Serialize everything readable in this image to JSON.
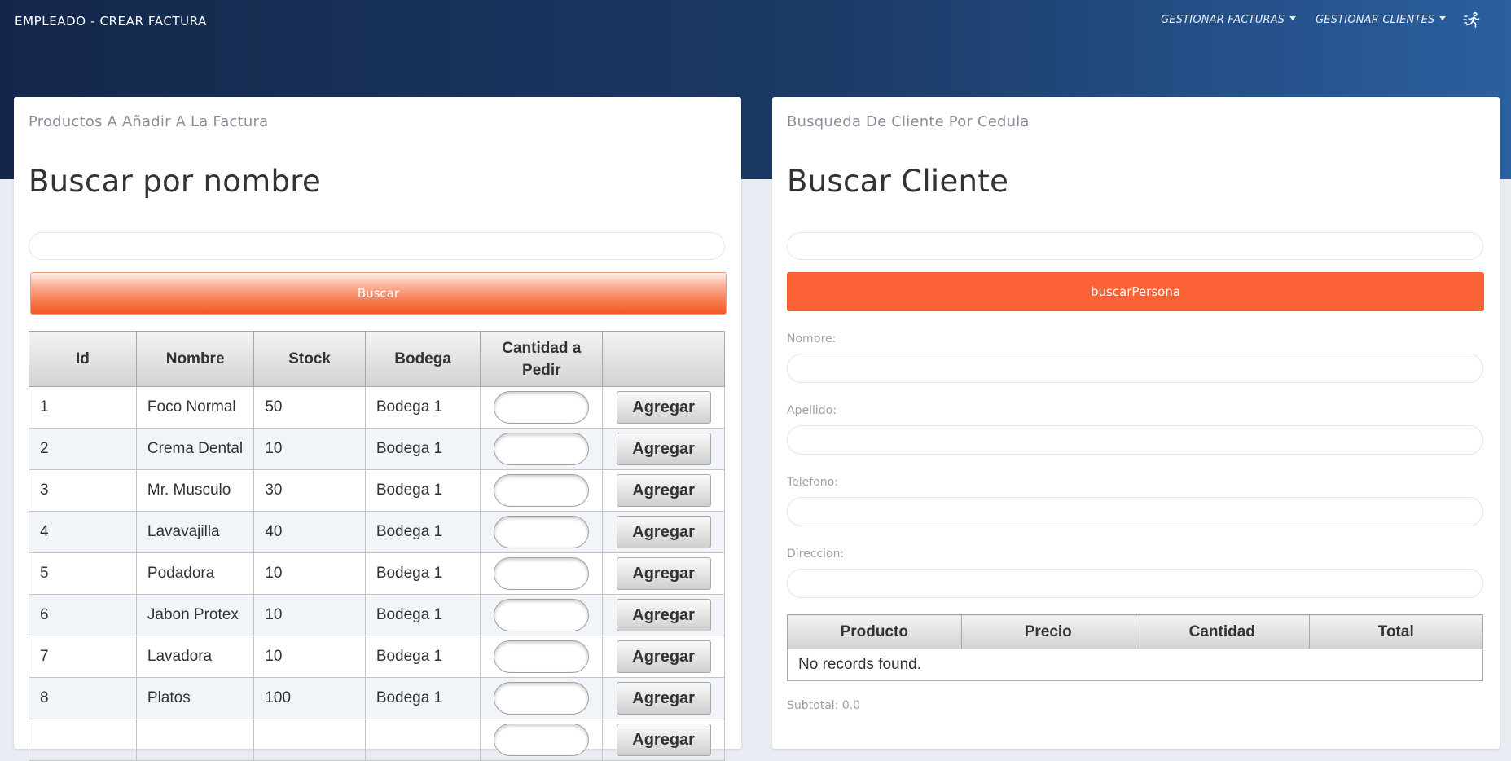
{
  "header": {
    "brand": "EMPLEADO - CREAR FACTURA",
    "menu": [
      {
        "label": "GESTIONAR FACTURAS"
      },
      {
        "label": "GESTIONAR CLIENTES"
      }
    ],
    "logout_icon": "running-person-icon"
  },
  "products_panel": {
    "header": "Productos A Añadir A La Factura",
    "heading": "Buscar por nombre",
    "search_value": "",
    "search_button": "Buscar",
    "columns": [
      "Id",
      "Nombre",
      "Stock",
      "Bodega",
      "Cantidad a Pedir",
      ""
    ],
    "add_label": "Agregar",
    "rows": [
      {
        "id": "1",
        "nombre": "Foco Normal",
        "stock": "50",
        "bodega": "Bodega 1"
      },
      {
        "id": "2",
        "nombre": "Crema Dental",
        "stock": "10",
        "bodega": "Bodega 1"
      },
      {
        "id": "3",
        "nombre": "Mr. Musculo",
        "stock": "30",
        "bodega": "Bodega 1"
      },
      {
        "id": "4",
        "nombre": "Lavavajilla",
        "stock": "40",
        "bodega": "Bodega 1"
      },
      {
        "id": "5",
        "nombre": "Podadora",
        "stock": "10",
        "bodega": "Bodega 1"
      },
      {
        "id": "6",
        "nombre": "Jabon Protex",
        "stock": "10",
        "bodega": "Bodega 1"
      },
      {
        "id": "7",
        "nombre": "Lavadora",
        "stock": "10",
        "bodega": "Bodega 1"
      },
      {
        "id": "8",
        "nombre": "Platos",
        "stock": "100",
        "bodega": "Bodega 1"
      },
      {
        "id": "",
        "nombre": "",
        "stock": "",
        "bodega": ""
      }
    ]
  },
  "client_panel": {
    "header": "Busqueda De Cliente Por Cedula",
    "heading": "Buscar Cliente",
    "search_value": "",
    "search_button": "buscarPersona",
    "fields": [
      {
        "label": "Nombre:",
        "value": ""
      },
      {
        "label": "Apellido:",
        "value": ""
      },
      {
        "label": "Telefono:",
        "value": ""
      },
      {
        "label": "Direccion:",
        "value": ""
      }
    ],
    "cart_columns": [
      "Producto",
      "Precio",
      "Cantidad",
      "Total"
    ],
    "empty_message": "No records found.",
    "subtotal": "Subtotal: 0.0"
  },
  "colors": {
    "nav_gradient_start": "#13274a",
    "nav_gradient_end": "#2a5fa0",
    "accent_orange": "#fb6235",
    "page_background": "#e9ecf2"
  }
}
